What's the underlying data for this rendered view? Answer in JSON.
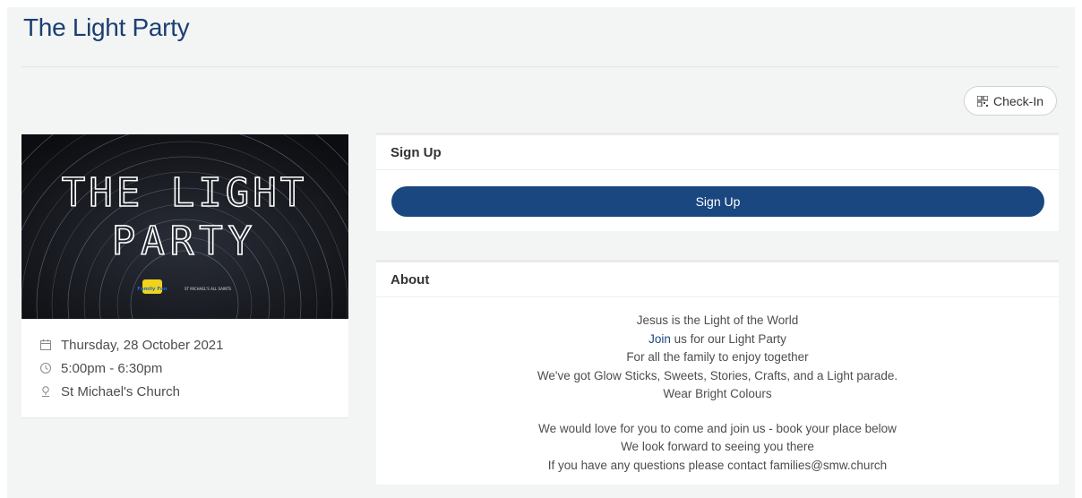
{
  "page": {
    "title": "The Light Party"
  },
  "toolbar": {
    "checkin_label": "Check-In"
  },
  "event": {
    "image_title_line1": "THE LIGHT",
    "image_title_line2": "PARTY",
    "image_logo_left": "Family Fun",
    "image_logo_right": "ST MICHAEL'S ALL SAINTS",
    "date": "Thursday, 28 October 2021",
    "time": "5:00pm - 6:30pm",
    "location": "St Michael's Church"
  },
  "signup": {
    "heading": "Sign Up",
    "button_label": "Sign Up"
  },
  "about": {
    "heading": "About",
    "line1": "Jesus is the Light of the World",
    "line2_link": "Join",
    "line2_rest": " us for our Light Party",
    "line3": "For all the family to enjoy together",
    "line4": "We've got Glow Sticks, Sweets, Stories, Crafts, and a Light parade.",
    "line5": "Wear Bright Colours",
    "line6": "We would love for you to come and join us - book your place below",
    "line7": "We look forward to seeing you there",
    "line8": "If you have any questions please contact families@smw.church"
  },
  "colors": {
    "primary": "#1a4780",
    "title": "#1a3f73",
    "background": "#f3f4f4"
  },
  "icons": {
    "checkin": "qr-code-icon",
    "date": "calendar-icon",
    "time": "clock-icon",
    "location": "map-pin-icon"
  }
}
